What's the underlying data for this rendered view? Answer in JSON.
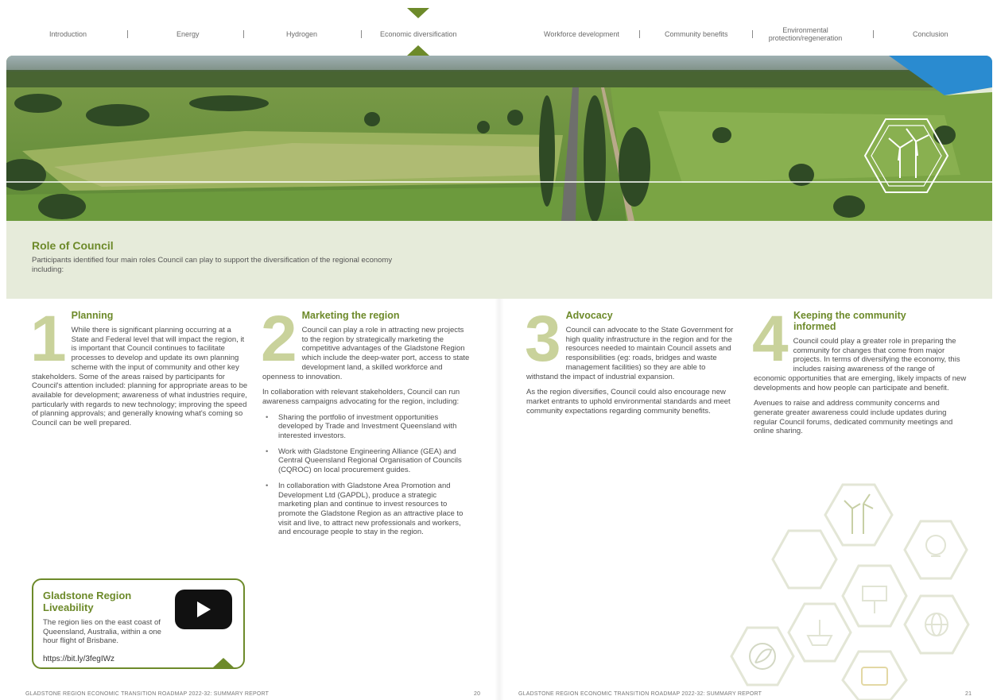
{
  "nav": {
    "items": [
      {
        "label": "Introduction"
      },
      {
        "label": "Energy"
      },
      {
        "label": "Hydrogen"
      },
      {
        "label": "Economic diversification"
      },
      {
        "label": "Workforce development"
      },
      {
        "label": "Community benefits"
      },
      {
        "label": "Environmental protection/regeneration"
      },
      {
        "label": "Conclusion"
      }
    ],
    "active": "Economic diversification",
    "accent_color": "#6d8a2a"
  },
  "role": {
    "title": "Role of Council",
    "text": "Participants identified four main roles Council can play to support the diversification of the regional economy including:"
  },
  "sections": [
    {
      "number": "1",
      "title": "Planning",
      "paragraphs": [
        "While there is significant planning occurring at a State and Federal level that will impact the region, it is important that Council continues to facilitate processes to develop and update its own planning scheme with the input of community and other key stakeholders. Some of the areas raised by participants for Council's attention included: planning for appropriate areas to be available for development; awareness of what industries require, particularly with regards to new technology; improving the speed of planning approvals; and generally knowing what's coming so Council can be well prepared."
      ]
    },
    {
      "number": "2",
      "title": "Marketing the region",
      "paragraphs": [
        "Council can play a role in attracting new projects to the region by strategically marketing the competitive advantages of the Gladstone Region which include the deep-water port, access to state development land, a skilled workforce and openness to innovation.",
        "In collaboration with relevant stakeholders, Council can run awareness campaigns advocating for the region, including:"
      ],
      "bullets": [
        "Sharing the portfolio of investment opportunities developed by Trade and Investment Queensland with interested investors.",
        "Work with Gladstone Engineering Alliance (GEA) and Central Queensland Regional Organisation of Councils (CQROC) on local procurement guides.",
        "In collaboration with Gladstone Area Promotion and Development Ltd (GAPDL), produce a strategic marketing plan and continue to invest resources to promote the Gladstone Region as an attractive place to visit and live, to attract new professionals and workers, and encourage people to stay in the region."
      ]
    },
    {
      "number": "3",
      "title": "Advocacy",
      "paragraphs": [
        "Council can advocate to the State Government for high quality infrastructure in the region and for the resources needed to maintain Council assets and responsibilities (eg: roads, bridges and waste management facilities) so they are able to withstand the impact of industrial expansion.",
        "As the region diversifies, Council could also encourage new market entrants to uphold environmental standards and meet community expectations regarding community benefits."
      ]
    },
    {
      "number": "4",
      "title": "Keeping the community informed",
      "paragraphs": [
        "Council could play a greater role in preparing the community for changes that come from major projects. In terms of diversifying the economy, this includes raising awareness of the range of economic opportunities that are emerging, likely impacts of new developments and how people can participate and benefit.",
        "Avenues to raise and address community concerns and generate greater awareness could include updates during regular Council forums, dedicated community meetings and online sharing."
      ]
    }
  ],
  "card": {
    "title": "Gladstone Region Liveability",
    "text": "The region lies on the east coast of Queensland, Australia, within a one hour flight of Brisbane.",
    "link": "https://bit.ly/3fegIWz",
    "video_icon": "play-icon"
  },
  "footer": {
    "left_title": "GLADSTONE REGION ECONOMIC TRANSITION ROADMAP 2022-32: SUMMARY REPORT",
    "left_page": "20",
    "right_title": "GLADSTONE REGION ECONOMIC TRANSITION ROADMAP 2022-32: SUMMARY REPORT",
    "right_page": "21"
  },
  "icons": [
    "wind-turbine-icon",
    "lightbulb-icon",
    "globe-icon",
    "solar-panel-icon",
    "ship-icon",
    "leaf-icon",
    "battery-icon"
  ]
}
